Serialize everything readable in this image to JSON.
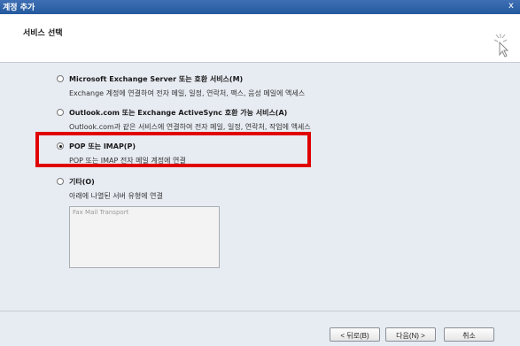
{
  "window": {
    "title": "계정 추가",
    "close_glyph": "x"
  },
  "header": {
    "heading": "서비스 선택"
  },
  "options": [
    {
      "label": "Microsoft Exchange Server 또는 호환 서비스(M)",
      "desc": "Exchange 계정에 연결하여 전자 메일, 일정, 연락처, 팩스, 음성 메일에 액세스",
      "checked": false
    },
    {
      "label": "Outlook.com 또는 Exchange ActiveSync 호환 가능 서비스(A)",
      "desc": "Outlook.com과 같은 서비스에 연결하여 전자 메일, 일정, 연락처, 작업에 액세스",
      "checked": false
    },
    {
      "label": "POP 또는 IMAP(P)",
      "desc": "POP 또는 IMAP 전자 메일 계정에 연결",
      "checked": true
    },
    {
      "label": "기타(O)",
      "desc": "아래에 나열된 서버 유형에 연결",
      "checked": false
    }
  ],
  "other_list": {
    "items": [
      "Fax Mail Transport"
    ]
  },
  "buttons": {
    "back": "< 뒤로(B)",
    "next": "다음(N) >",
    "cancel": "취소"
  },
  "colors": {
    "highlight": "#e00000",
    "titlebar": "#245a9f"
  },
  "icons": {
    "header_icon": "cursor-click-icon"
  }
}
